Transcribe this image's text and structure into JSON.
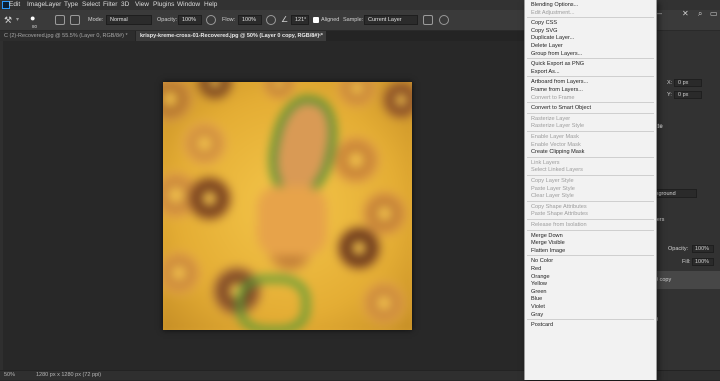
{
  "menubar": {
    "items": [
      "Edit",
      "Image",
      "Layer",
      "Type",
      "Select",
      "Filter",
      "3D",
      "View",
      "Plugins",
      "Window",
      "Help"
    ]
  },
  "options": {
    "mode_label": "Mode:",
    "mode_value": "Normal",
    "opacity_label": "Opacity:",
    "opacity_value": "100%",
    "flow_label": "Flow:",
    "flow_value": "100%",
    "angle_value": "121°",
    "aligned_label": "Aligned",
    "sample_label": "Sample:",
    "sample_value": "Current Layer",
    "brush_size": "80"
  },
  "tabs": [
    {
      "label": "C (2)-Recovered.jpg @ 55.5% (Layer 0, RGB/8#) *"
    },
    {
      "label": "krispy-kreme-cross-01-Recovered.jpg @ 50% (Layer 0 copy, RGB/8#) *"
    }
  ],
  "status": {
    "zoom": "50%",
    "doc_info": "1280 px x 1280 px (72 ppi)"
  },
  "right_panel": {
    "x_value": "0 px",
    "y_value": "0 px",
    "section_label": "ate",
    "background_label": "ckground",
    "layers_label": "yers",
    "opacity_label": "Opacity:",
    "opacity_value": "100%",
    "fill_label": "Fill:",
    "fill_value": "100%",
    "layer_copy": "0 copy",
    "layer0": "0"
  },
  "context_menu": {
    "items": [
      {
        "label": "Blending Options...",
        "enabled": true
      },
      {
        "label": "Edit Adjustment...",
        "enabled": false
      },
      {
        "sep": true
      },
      {
        "label": "Copy CSS",
        "enabled": true
      },
      {
        "label": "Copy SVG",
        "enabled": true
      },
      {
        "label": "Duplicate Layer...",
        "enabled": true
      },
      {
        "label": "Delete Layer",
        "enabled": true
      },
      {
        "label": "Group from Layers...",
        "enabled": true
      },
      {
        "sep": true
      },
      {
        "label": "Quick Export as PNG",
        "enabled": true
      },
      {
        "label": "Export As...",
        "enabled": true
      },
      {
        "sep": true
      },
      {
        "label": "Artboard from Layers...",
        "enabled": true
      },
      {
        "label": "Frame from Layers...",
        "enabled": true
      },
      {
        "label": "Convert to Frame",
        "enabled": false
      },
      {
        "sep": true
      },
      {
        "label": "Convert to Smart Object",
        "enabled": true
      },
      {
        "sep": true
      },
      {
        "label": "Rasterize Layer",
        "enabled": false
      },
      {
        "label": "Rasterize Layer Style",
        "enabled": false
      },
      {
        "sep": true
      },
      {
        "label": "Enable Layer Mask",
        "enabled": false
      },
      {
        "label": "Enable Vector Mask",
        "enabled": false
      },
      {
        "label": "Create Clipping Mask",
        "enabled": true
      },
      {
        "sep": true
      },
      {
        "label": "Link Layers",
        "enabled": false
      },
      {
        "label": "Select Linked Layers",
        "enabled": false
      },
      {
        "sep": true
      },
      {
        "label": "Copy Layer Style",
        "enabled": false
      },
      {
        "label": "Paste Layer Style",
        "enabled": false
      },
      {
        "label": "Clear Layer Style",
        "enabled": false
      },
      {
        "sep": true
      },
      {
        "label": "Copy Shape Attributes",
        "enabled": false
      },
      {
        "label": "Paste Shape Attributes",
        "enabled": false
      },
      {
        "sep": true
      },
      {
        "label": "Release from Isolation",
        "enabled": false
      },
      {
        "sep": true
      },
      {
        "label": "Merge Down",
        "enabled": true
      },
      {
        "label": "Merge Visible",
        "enabled": true
      },
      {
        "label": "Flatten Image",
        "enabled": true
      },
      {
        "sep": true
      },
      {
        "label": "No Color",
        "enabled": true
      },
      {
        "label": "Red",
        "enabled": true
      },
      {
        "label": "Orange",
        "enabled": true
      },
      {
        "label": "Yellow",
        "enabled": true
      },
      {
        "label": "Green",
        "enabled": true
      },
      {
        "label": "Blue",
        "enabled": true
      },
      {
        "label": "Violet",
        "enabled": true
      },
      {
        "label": "Gray",
        "enabled": true
      },
      {
        "sep": true
      },
      {
        "label": "Postcard",
        "enabled": true
      }
    ]
  },
  "colors": {
    "menu_bg": "#f2f2f2",
    "app_bg": "#282828",
    "canvas_yellow": "#e9b63c",
    "accent_blue": "#2b9bff"
  }
}
